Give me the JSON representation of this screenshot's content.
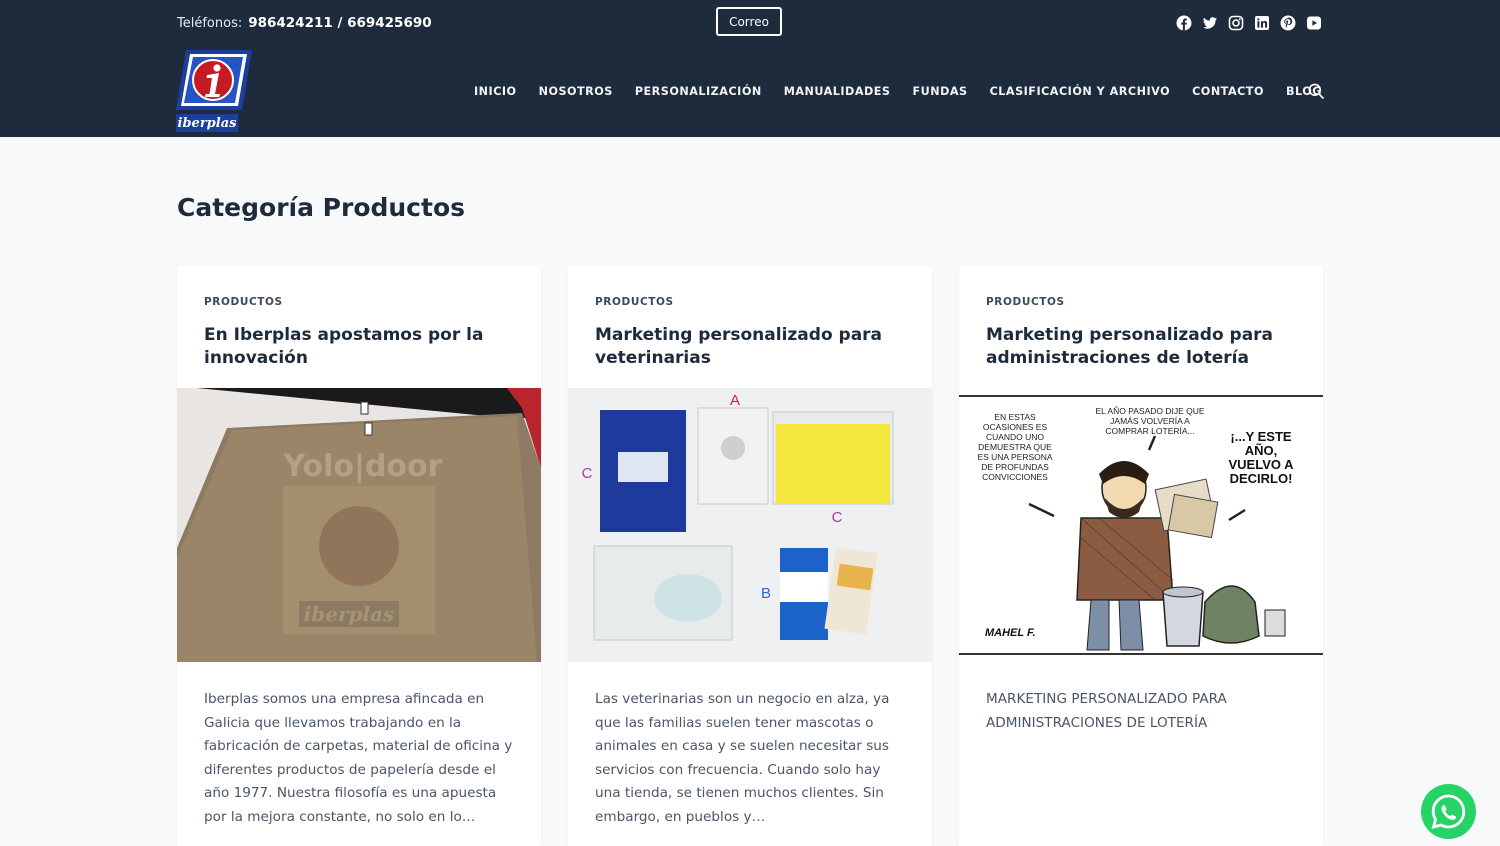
{
  "topbar": {
    "phone_label": "Teléfonos:",
    "phone_numbers": "986424211 / 669425690",
    "mail_button": "Correo",
    "socials": [
      "facebook-icon",
      "twitter-icon",
      "instagram-icon",
      "linkedin-icon",
      "pinterest-icon",
      "youtube-icon"
    ]
  },
  "logo": {
    "text": "iberplas"
  },
  "nav": {
    "items": [
      "INICIO",
      "NOSOTROS",
      "PERSONALIZACIÓN",
      "MANUALIDADES",
      "FUNDAS",
      "CLASIFICACIÓN Y ARCHIVO",
      "CONTACTO",
      "BLOG"
    ]
  },
  "page": {
    "title": "Categoría Productos"
  },
  "posts": [
    {
      "category": "PRODUCTOS",
      "title": "En Iberplas apostamos por la innovación",
      "excerpt": "Iberplas somos una empresa afincada en Galicia que llevamos trabajando en la fabricación de carpetas, material de oficina y diferentes productos de papelería desde el año 1977. Nuestra filosofía es una apuesta por la mejora constante, no solo en lo…",
      "image_text": "Yolo|door",
      "image_logo_text": "iberplas"
    },
    {
      "category": "PRODUCTOS",
      "title": "Marketing personalizado para veterinarias",
      "excerpt": "Las veterinarias son un negocio en alza, ya que las familias suelen tener mascotas o animales en casa y se suelen necesitar sus servicios con frecuencia. Cuando solo hay una tienda, se tienen muchos clientes. Sin embargo, en pueblos y…",
      "image_labels": [
        "A",
        "C",
        "C",
        "B"
      ]
    },
    {
      "category": "PRODUCTOS",
      "title": "Marketing personalizado para administraciones de lotería",
      "excerpt": "MARKETING PERSONALIZADO PARA ADMINISTRACIONES DE LOTERÍA",
      "cartoon_text_left": "EN ESTAS OCASIONES ES CUANDO UNO DEMUESTRA QUE ES UNA PERSONA DE PROFUNDAS CONVICCIONES",
      "cartoon_text_top": "EL AÑO PASADO DIJE QUE JAMÁS VOLVERÍA A COMPRAR LOTERÍA...",
      "cartoon_text_right": "¡...Y ESTE AÑO, VUELVO A DECIRLO!",
      "cartoon_signature": "MAHEL F."
    }
  ],
  "colors": {
    "header_bg": "#1e2b3c",
    "page_bg": "#f8f9fa",
    "whatsapp": "#25d366"
  },
  "floating": {
    "whatsapp_icon": "whatsapp-icon"
  }
}
